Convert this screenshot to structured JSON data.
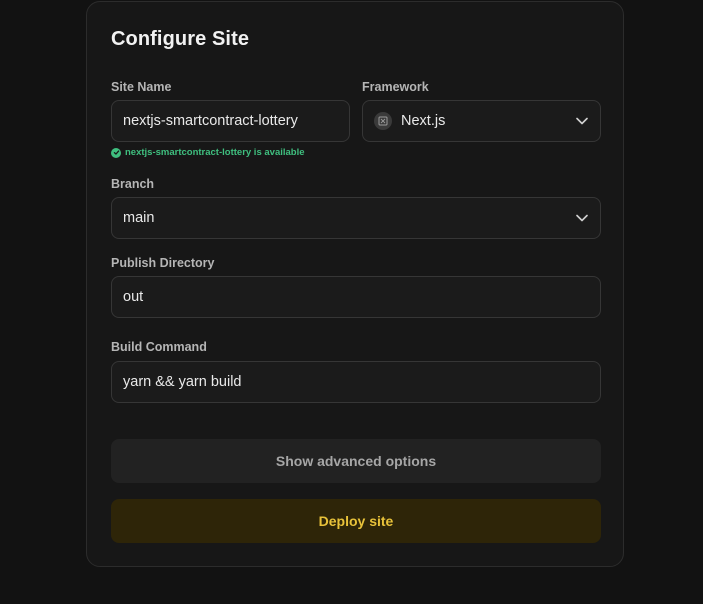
{
  "form": {
    "title": "Configure Site",
    "site_name": {
      "label": "Site Name",
      "value": "nextjs-smartcontract-lottery",
      "availability": "nextjs-smartcontract-lottery is available"
    },
    "framework": {
      "label": "Framework",
      "value": "Next.js",
      "icon": "nextjs-icon"
    },
    "branch": {
      "label": "Branch",
      "value": "main"
    },
    "publish_directory": {
      "label": "Publish Directory",
      "value": "out"
    },
    "build_command": {
      "label": "Build Command",
      "value": "yarn && yarn build"
    },
    "advanced_label": "Show advanced options",
    "deploy_label": "Deploy site"
  },
  "colors": {
    "background": "#121212",
    "card": "#171717",
    "success": "#3fbf7f",
    "deploy_bg": "#2e2508",
    "deploy_text": "#e8c23a"
  }
}
